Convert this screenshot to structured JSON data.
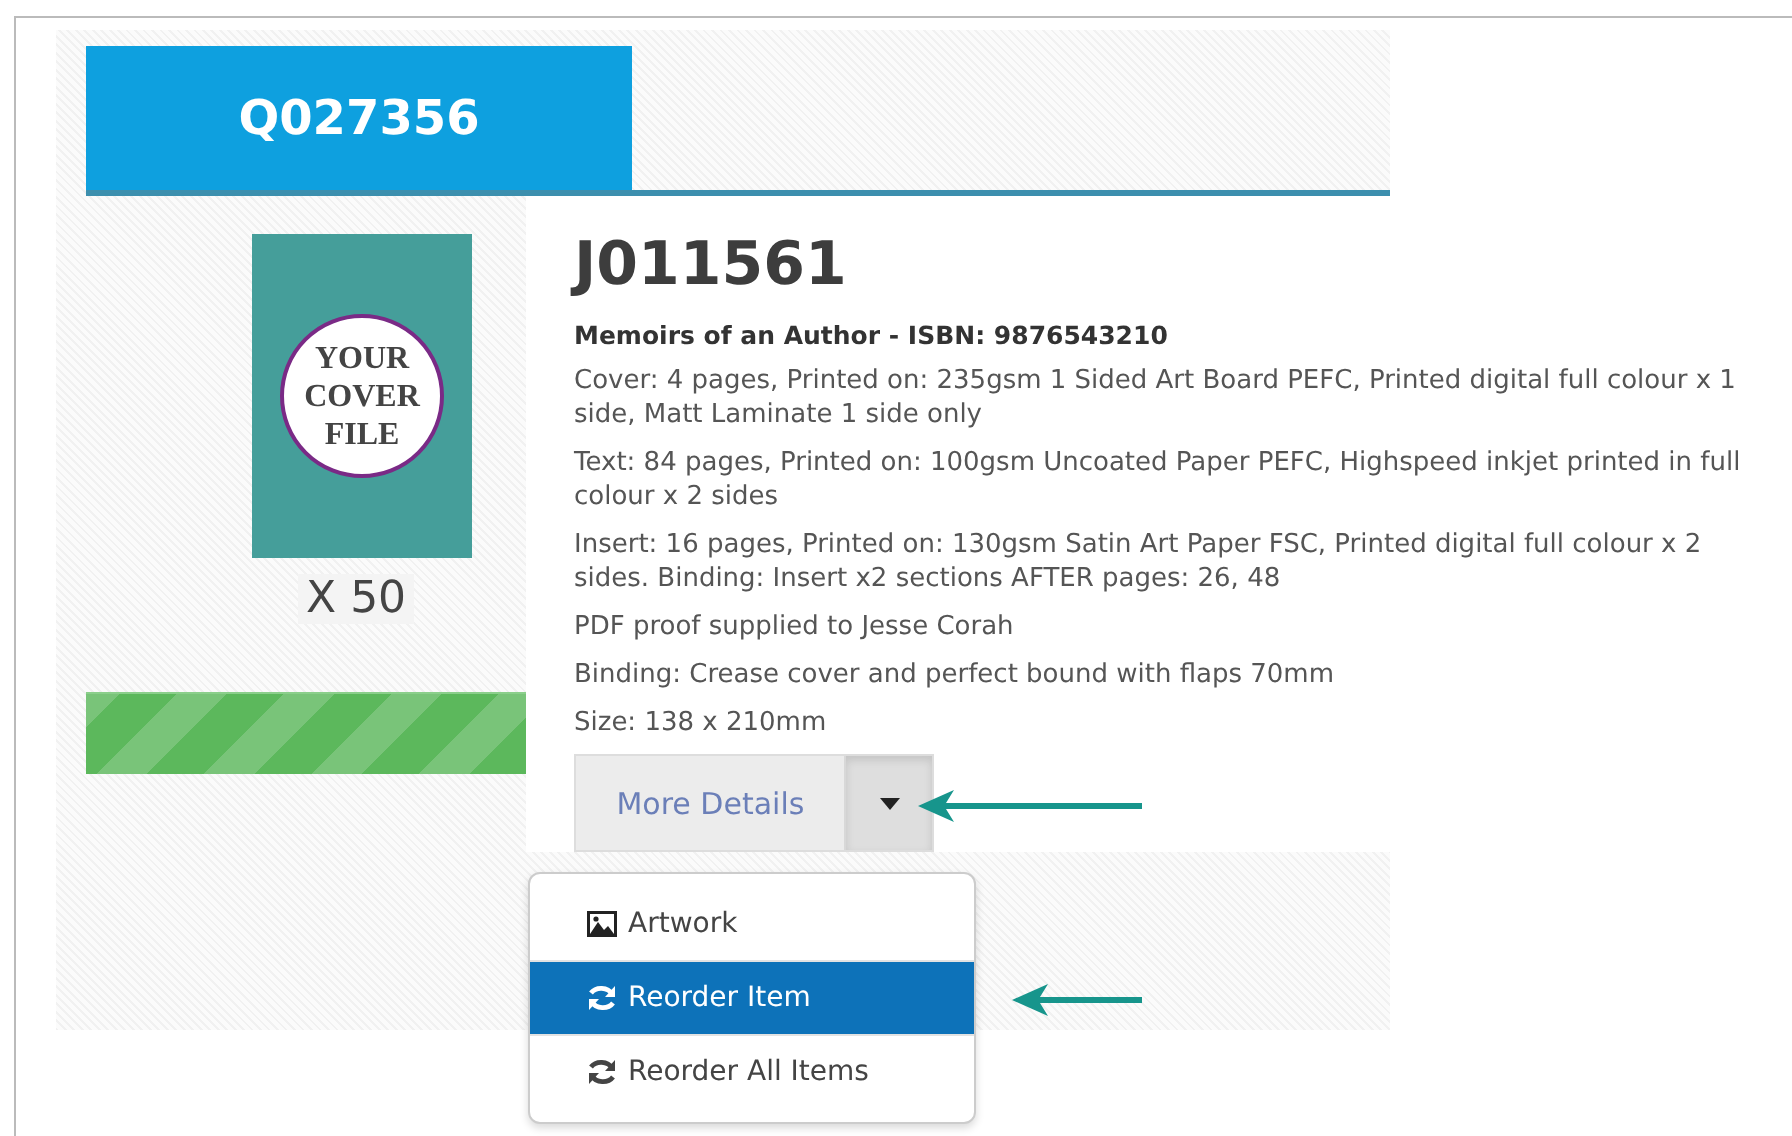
{
  "tab": {
    "label": "Q027356",
    "selected": true
  },
  "cover": {
    "caption": "YOUR COVER FILE"
  },
  "quantity": "X 50",
  "progress": {
    "level": 1
  },
  "job": {
    "number": "J011561",
    "title": "Memoirs of an Author - ISBN: 9876543210",
    "specs": [
      "Cover: 4 pages, Printed on: 235gsm 1 Sided Art Board PEFC, Printed digital full colour x 1 side, Matt Laminate 1 side only",
      "Text: 84 pages, Printed on: 100gsm Uncoated Paper PEFC, Highspeed inkjet printed in full colour x 2 sides",
      "Insert: 16 pages, Printed on: 130gsm Satin Art Paper FSC, Printed digital full colour x 2 sides. Binding: Insert x2 sections AFTER pages: 26, 48",
      "PDF proof supplied to Jesse Corah",
      "Binding: Crease cover and perfect bound with flaps 70mm",
      "Size: 138 x 210mm"
    ]
  },
  "actions": {
    "label": "More Details",
    "expanded": true
  },
  "menu": [
    {
      "label": "Artwork",
      "kind": "image",
      "selected": false
    },
    {
      "label": "Reorder Item",
      "kind": "refresh",
      "selected": true
    },
    {
      "label": "Reorder All Items",
      "kind": "refresh",
      "selected": false
    }
  ]
}
